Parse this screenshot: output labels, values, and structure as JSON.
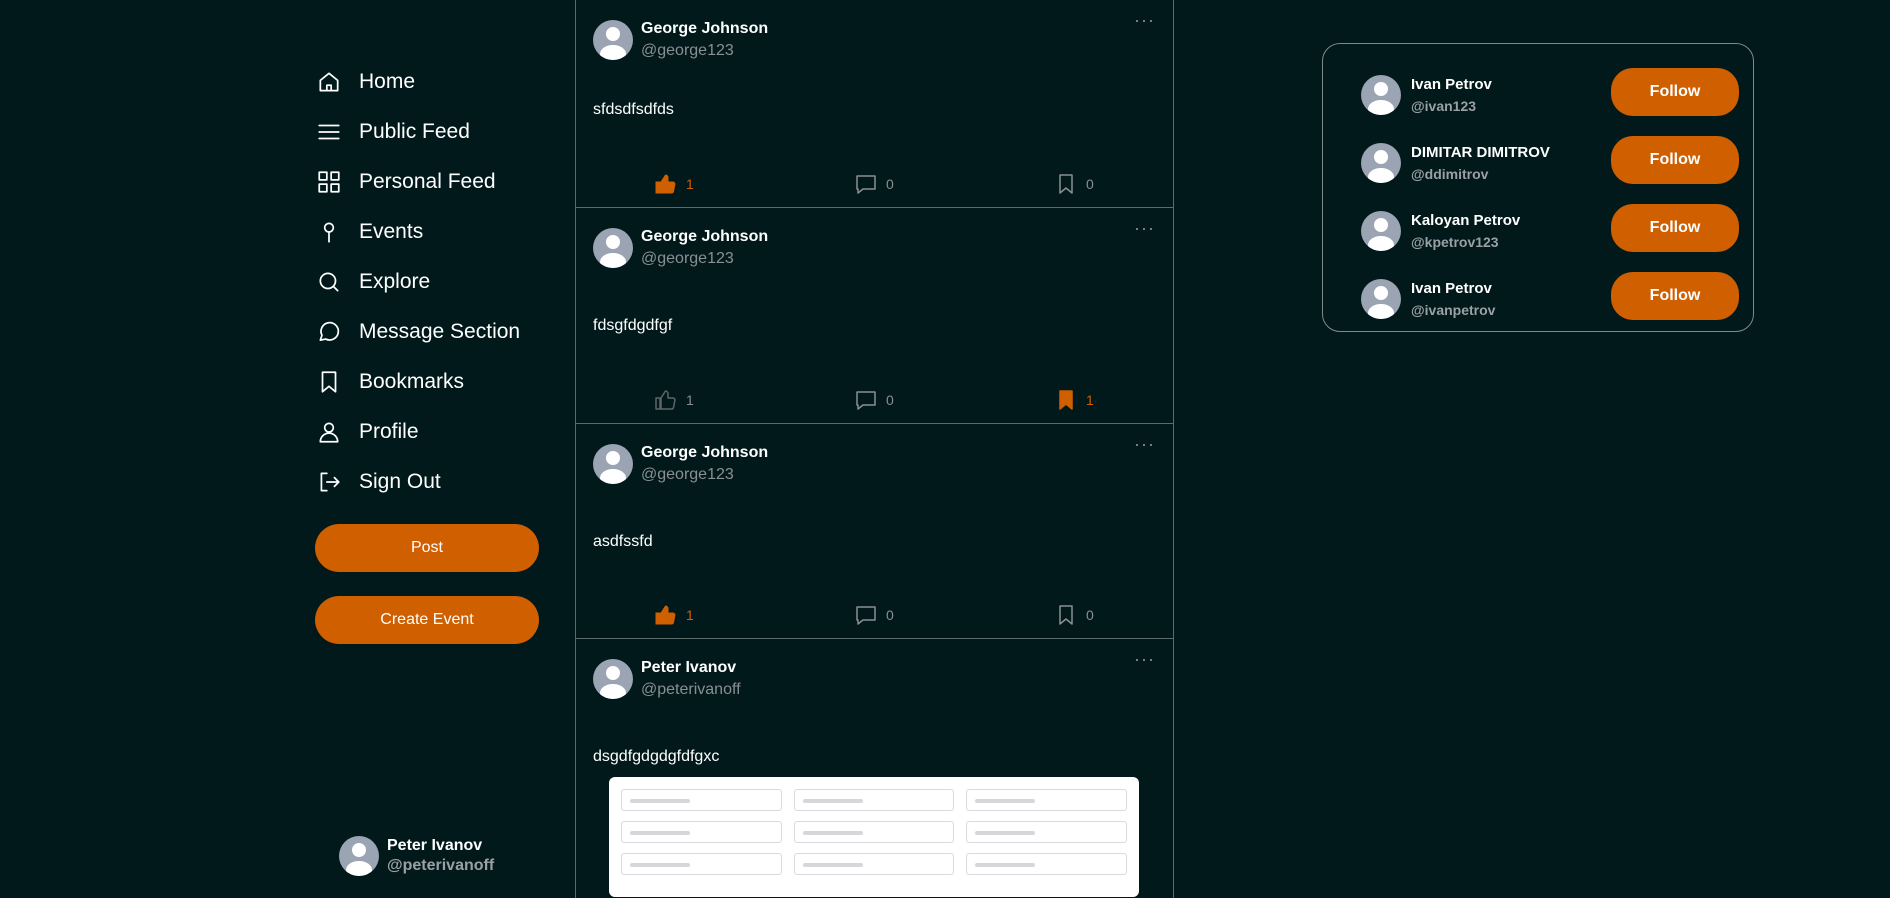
{
  "sidebar": {
    "nav": [
      {
        "label": "Home",
        "icon": "home-icon"
      },
      {
        "label": "Public Feed",
        "icon": "menu-icon"
      },
      {
        "label": "Personal Feed",
        "icon": "grid-icon"
      },
      {
        "label": "Events",
        "icon": "pin-icon"
      },
      {
        "label": "Explore",
        "icon": "search-icon"
      },
      {
        "label": "Message Section",
        "icon": "chat-icon"
      },
      {
        "label": "Bookmarks",
        "icon": "bookmark-icon"
      },
      {
        "label": "Profile",
        "icon": "user-icon"
      },
      {
        "label": "Sign Out",
        "icon": "sign-out-icon"
      }
    ],
    "post_label": "Post",
    "create_event_label": "Create Event",
    "current_user": {
      "name": "Peter Ivanov",
      "handle": "@peterivanoff"
    }
  },
  "feed": {
    "posts": [
      {
        "author": "George Johnson",
        "handle": "@george123",
        "text": "sfdsdfsdfds",
        "likes": "1",
        "liked": true,
        "comments": "0",
        "bookmarks": "0",
        "bookmarked": false
      },
      {
        "author": "George Johnson",
        "handle": "@george123",
        "text": "fdsgfdgdfgf",
        "likes": "1",
        "liked": false,
        "comments": "0",
        "bookmarks": "1",
        "bookmarked": true
      },
      {
        "author": "George Johnson",
        "handle": "@george123",
        "text": "asdfssfd",
        "likes": "1",
        "liked": true,
        "comments": "0",
        "bookmarks": "0",
        "bookmarked": false
      },
      {
        "author": "Peter Ivanov",
        "handle": "@peterivanoff",
        "text": "dsgdfgdgdgfdfgxc",
        "has_image": true
      }
    ],
    "more_label": "···"
  },
  "suggestions": {
    "follow_label": "Follow",
    "users": [
      {
        "name": "Ivan Petrov",
        "handle": "@ivan123"
      },
      {
        "name": "DIMITAR DIMITROV",
        "handle": "@ddimitrov"
      },
      {
        "name": "Kaloyan Petrov",
        "handle": "@kpetrov123"
      },
      {
        "name": "Ivan Petrov",
        "handle": "@ivanpetrov"
      }
    ]
  },
  "colors": {
    "accent": "#d05f00",
    "background": "#01191a",
    "muted": "#8a8f94"
  }
}
